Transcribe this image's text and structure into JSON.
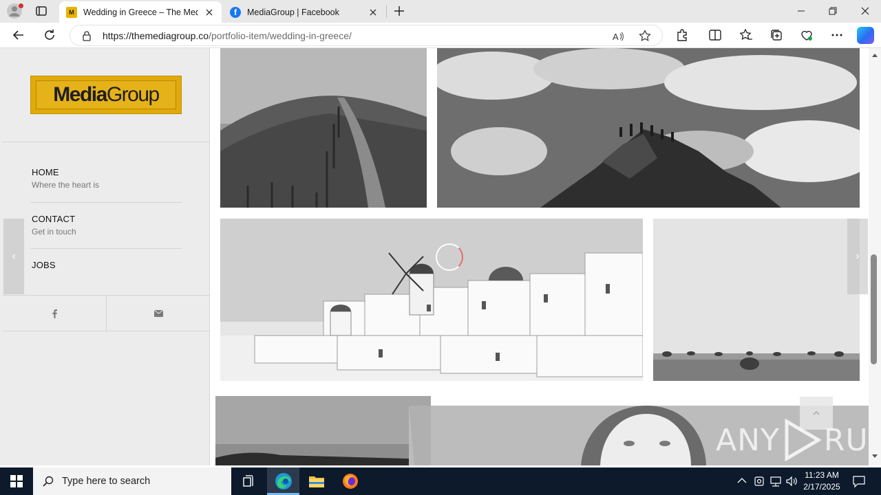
{
  "browser": {
    "tabs": [
      {
        "title": "Wedding in Greece – The Media",
        "favicon": "mediagroup-favicon",
        "active": true
      },
      {
        "title": "MediaGroup | Facebook",
        "favicon": "facebook-favicon",
        "active": false
      }
    ],
    "url_host": "https://themediagroup.co",
    "url_path": "/portfolio-item/wedding-in-greece/"
  },
  "sidebar": {
    "logo": {
      "bold": "Media",
      "light": "Group"
    },
    "nav": [
      {
        "label": "HOME",
        "sub": "Where the heart is"
      },
      {
        "label": "CONTACT",
        "sub": "Get in touch"
      },
      {
        "label": "JOBS",
        "sub": ""
      }
    ],
    "social": [
      "facebook-icon",
      "mail-icon"
    ]
  },
  "gallery": {
    "photos": [
      "hillside-fence-path",
      "people-on-rocky-peak",
      "santorini-windmill-village",
      "hay-bales-field",
      "woman-portrait",
      "seaside-cliff"
    ],
    "prev_arrow": "‹",
    "next_arrow": "›"
  },
  "watermark": {
    "left": "ANY",
    "right": "RUN"
  },
  "taskbar": {
    "search_placeholder": "Type here to search",
    "time": "11:23 AM",
    "date": "2/17/2025"
  },
  "colors": {
    "brand": "#e0aa0b",
    "facebook": "#1877f2",
    "taskbar": "#0c1a2c"
  }
}
